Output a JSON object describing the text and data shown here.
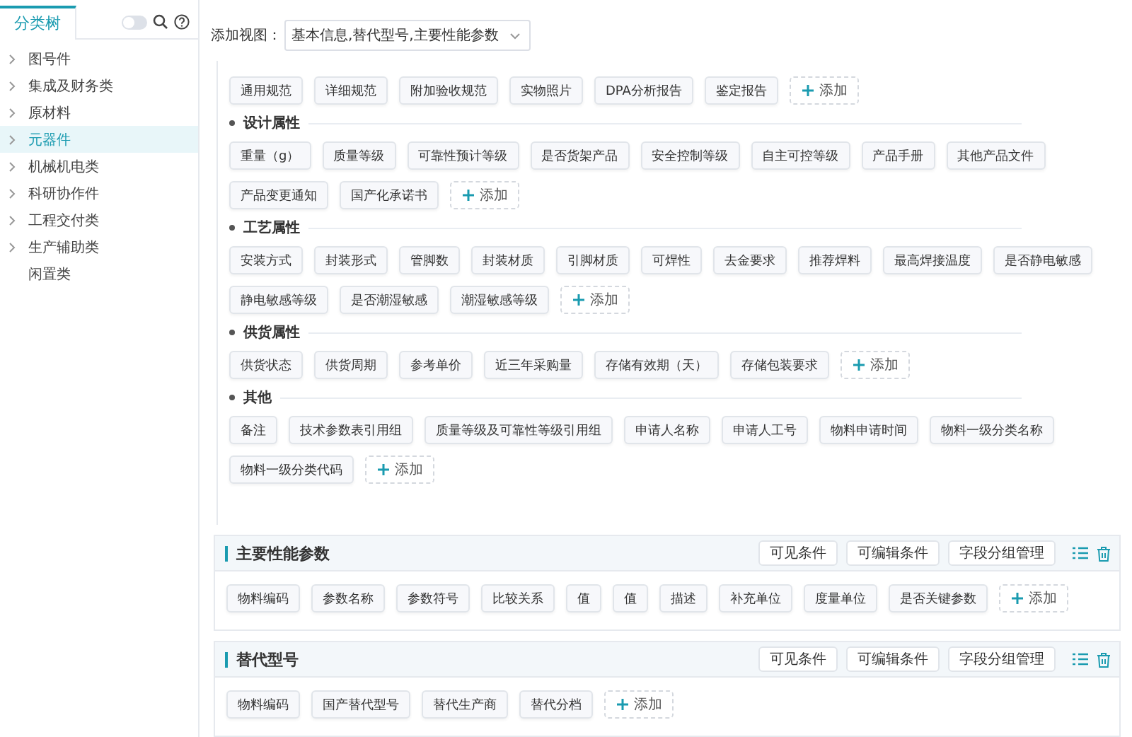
{
  "sidebar": {
    "tab": {
      "label": "分类树",
      "selected": true
    },
    "toggle": {
      "on": false
    },
    "items": [
      {
        "label": "图号件",
        "selected": false,
        "expandable": true
      },
      {
        "label": "集成及财务类",
        "selected": false,
        "expandable": true
      },
      {
        "label": "原材料",
        "selected": false,
        "expandable": true
      },
      {
        "label": "元器件",
        "selected": true,
        "expandable": true
      },
      {
        "label": "机械机电类",
        "selected": false,
        "expandable": true
      },
      {
        "label": "科研协作件",
        "selected": false,
        "expandable": true
      },
      {
        "label": "工程交付类",
        "selected": false,
        "expandable": true
      },
      {
        "label": "生产辅助类",
        "selected": false,
        "expandable": true
      },
      {
        "label": "闲置类",
        "selected": false,
        "expandable": false
      }
    ]
  },
  "view_selector": {
    "label": "添加视图：",
    "value": "基本信息,替代型号,主要性能参数"
  },
  "attribute_groups": [
    {
      "fields": [
        "通用规范",
        "详细规范",
        "附加验收规范",
        "实物照片",
        "DPA分析报告",
        "鉴定报告"
      ],
      "add_label": "添加"
    },
    {
      "title": "设计属性",
      "fields": [
        "重量（g）",
        "质量等级",
        "可靠性预计等级",
        "是否货架产品",
        "安全控制等级",
        "自主可控等级",
        "产品手册",
        "其他产品文件",
        "产品变更通知",
        "国产化承诺书"
      ],
      "add_label": "添加"
    },
    {
      "title": "工艺属性",
      "fields": [
        "安装方式",
        "封装形式",
        "管脚数",
        "封装材质",
        "引脚材质",
        "可焊性",
        "去金要求",
        "推荐焊料",
        "最高焊接温度",
        "是否静电敏感",
        "静电敏感等级",
        "是否潮湿敏感",
        "潮湿敏感等级"
      ],
      "add_label": "添加"
    },
    {
      "title": "供货属性",
      "fields": [
        "供货状态",
        "供货周期",
        "参考单价",
        "近三年采购量",
        "存储有效期（天）",
        "存储包装要求"
      ],
      "add_label": "添加"
    },
    {
      "title": "其他",
      "fields": [
        "备注",
        "技术参数表引用组",
        "质量等级及可靠性等级引用组",
        "申请人名称",
        "申请人工号",
        "物料申请时间",
        "物料一级分类名称",
        "物料一级分类代码"
      ],
      "add_label": "添加"
    }
  ],
  "sections": [
    {
      "title": "主要性能参数",
      "buttons": [
        "可见条件",
        "可编辑条件",
        "字段分组管理"
      ],
      "fields": [
        "物料编码",
        "参数名称",
        "参数符号",
        "比较关系",
        "值",
        "值",
        "描述",
        "补充单位",
        "度量单位",
        "是否关键参数"
      ],
      "add_label": "添加"
    },
    {
      "title": "替代型号",
      "buttons": [
        "可见条件",
        "可编辑条件",
        "字段分组管理"
      ],
      "fields": [
        "物料编码",
        "国产替代型号",
        "替代生产商",
        "替代分档"
      ],
      "add_label": "添加"
    }
  ]
}
